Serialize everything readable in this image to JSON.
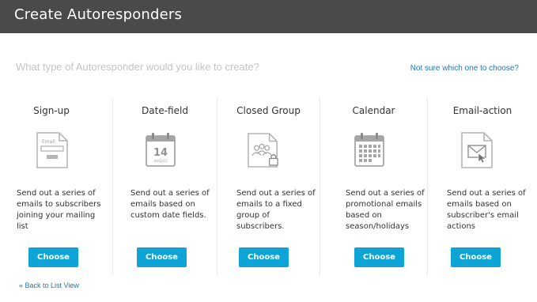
{
  "header": {
    "title": "Create Autoresponders"
  },
  "intro": {
    "question": "What type of Autoresponder would you like to create?",
    "help_link": "Not sure which one to choose?"
  },
  "cards": [
    {
      "title": "Sign-up",
      "icon": "signup-form-icon",
      "icon_text": "Email",
      "description": "Send out a series of emails to subscribers joining your mailing list",
      "button": "Choose"
    },
    {
      "title": "Date-field",
      "icon": "date-calendar-icon",
      "icon_text": "14",
      "icon_subtext": "AUGUST",
      "description": "Send out a series of emails based on custom date fields.",
      "button": "Choose"
    },
    {
      "title": "Closed Group",
      "icon": "group-lock-icon",
      "description": "Send out a series of emails to a fixed group of subscribers.",
      "button": "Choose"
    },
    {
      "title": "Calendar",
      "icon": "calendar-grid-icon",
      "description": "Send out a series of promotional emails based on season/holidays",
      "button": "Choose"
    },
    {
      "title": "Email-action",
      "icon": "email-action-icon",
      "description": "Send out a series of emails based on subscriber's email actions",
      "button": "Choose"
    }
  ],
  "footer": {
    "back_link": "« Back to List View"
  }
}
